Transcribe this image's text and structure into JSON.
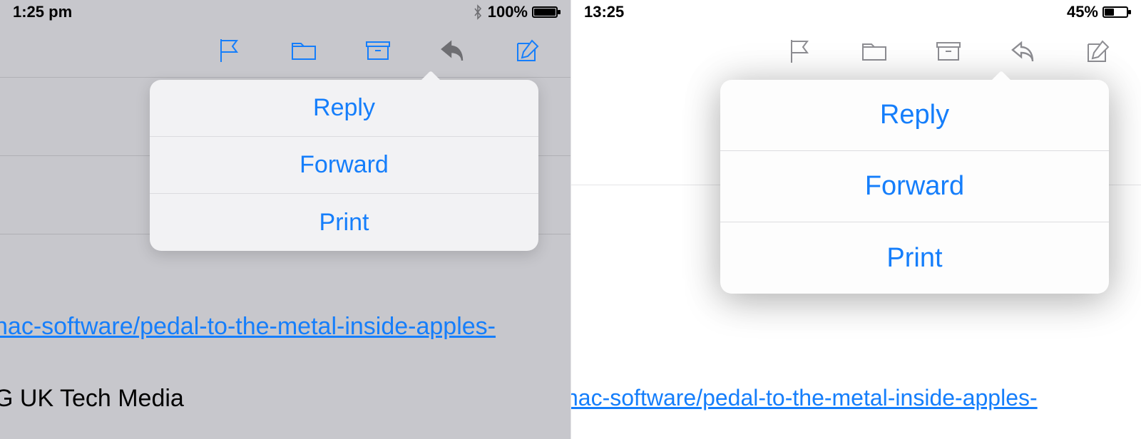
{
  "left": {
    "status": {
      "time": "1:25 pm",
      "battery_pct": "100%",
      "battery_fill": 100,
      "bluetooth": true
    },
    "toolbar_icons": [
      "flag",
      "folder",
      "archive",
      "reply",
      "compose"
    ],
    "popover": {
      "items": [
        "Reply",
        "Forward",
        "Print"
      ]
    },
    "link_text": "nac-software/pedal-to-the-metal-inside-apples-",
    "body_text": "G UK Tech Media"
  },
  "right": {
    "status": {
      "time": "13:25",
      "battery_pct": "45%",
      "battery_fill": 45,
      "bluetooth": false
    },
    "toolbar_icons": [
      "flag",
      "folder",
      "archive",
      "reply",
      "compose"
    ],
    "popover": {
      "items": [
        "Reply",
        "Forward",
        "Print"
      ]
    },
    "link_text": "nac-software/pedal-to-the-metal-inside-apples-"
  }
}
